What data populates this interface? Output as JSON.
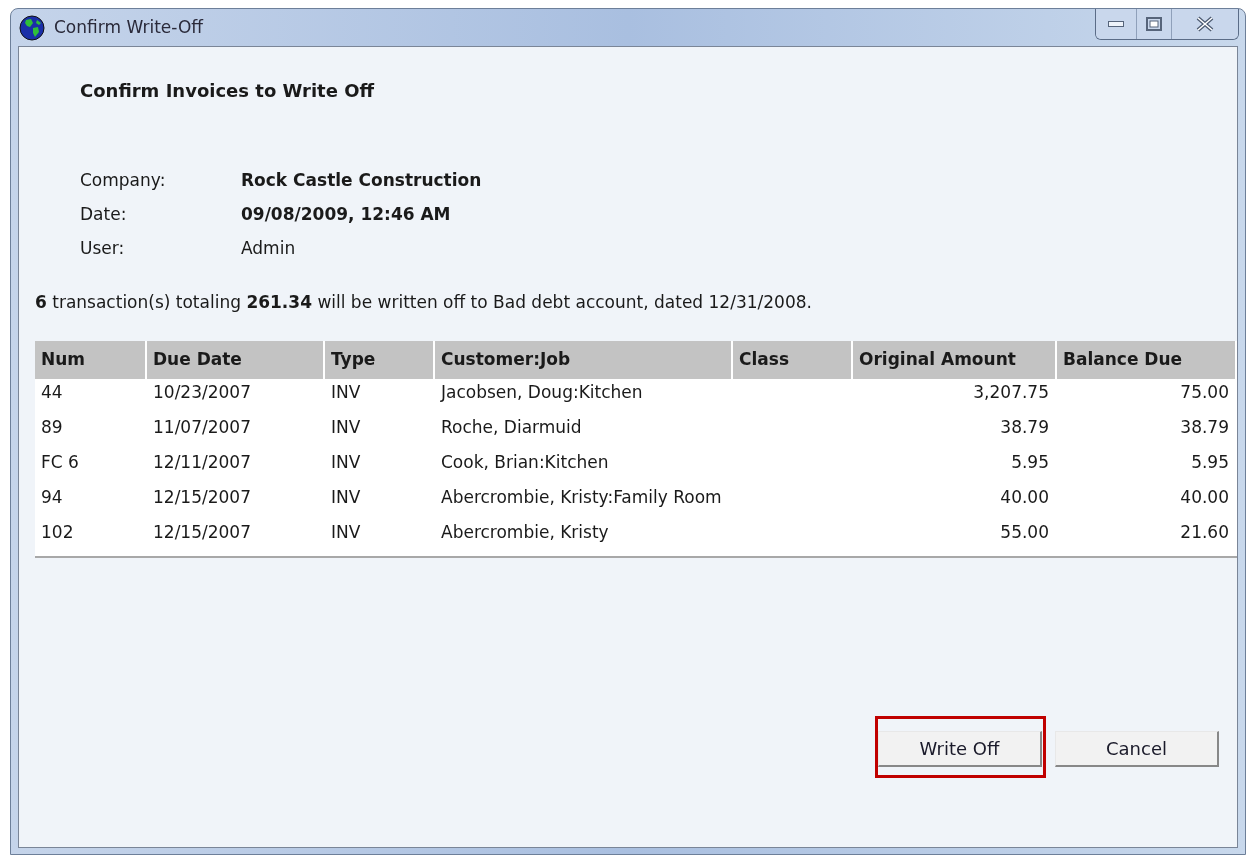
{
  "window": {
    "title": "Confirm Write-Off"
  },
  "heading": "Confirm Invoices to Write Off",
  "info": [
    {
      "label": "Company:",
      "value": "Rock Castle Construction",
      "bold": true
    },
    {
      "label": "Date:",
      "value": "09/08/2009, 12:46 AM",
      "bold": true
    },
    {
      "label": "User:",
      "value": "Admin",
      "bold": false
    }
  ],
  "summary": "**6** transaction(s) totaling **261.34** will be written off to Bad debt account, dated 12/31/2008.",
  "table": {
    "columns": [
      "Num",
      "Due Date",
      "Type",
      "Customer:Job",
      "Class",
      "Original Amount",
      "Balance Due"
    ],
    "rows": [
      [
        "44",
        "10/23/2007",
        "INV",
        "Jacobsen, Doug:Kitchen",
        "",
        "3,207.75",
        "75.00"
      ],
      [
        "89",
        "11/07/2007",
        "INV",
        "Roche, Diarmuid",
        "",
        "38.79",
        "38.79"
      ],
      [
        "FC 6",
        "12/11/2007",
        "INV",
        "Cook, Brian:Kitchen",
        "",
        "5.95",
        "5.95"
      ],
      [
        "94",
        "12/15/2007",
        "INV",
        "Abercrombie, Kristy:Family Room",
        "",
        "40.00",
        "40.00"
      ],
      [
        "102",
        "12/15/2007",
        "INV",
        "Abercrombie, Kristy",
        "",
        "55.00",
        "21.60"
      ]
    ]
  },
  "buttons": [
    {
      "label": "Write Off",
      "highlighted": true
    },
    {
      "label": "Cancel",
      "highlighted": false
    }
  ]
}
